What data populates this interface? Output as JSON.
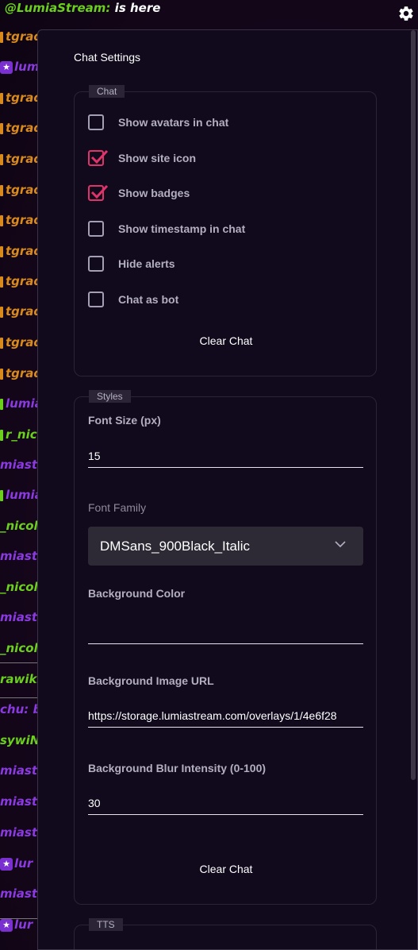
{
  "chat_feed": {
    "top_name": "@LumiaStream:",
    "top_msg": "is here",
    "lines": [
      {
        "text": "tgrad",
        "color": "orange",
        "mark": "dot-orange"
      },
      {
        "text": "lum",
        "color": "purple",
        "mark": "star"
      },
      {
        "text": "tgrad",
        "color": "orange",
        "mark": "dot-orange"
      },
      {
        "text": "tgrad",
        "color": "orange",
        "mark": "dot-orange"
      },
      {
        "text": "tgrad",
        "color": "orange",
        "mark": "dot-orange"
      },
      {
        "text": "tgrad",
        "color": "orange",
        "mark": "dot-orange"
      },
      {
        "text": "tgrad",
        "color": "orange",
        "mark": "dot-orange"
      },
      {
        "text": "tgrad",
        "color": "orange",
        "mark": "dot-orange"
      },
      {
        "text": "tgrad",
        "color": "orange",
        "mark": "dot-orange"
      },
      {
        "text": "tgrad",
        "color": "orange",
        "mark": "dot-orange"
      },
      {
        "text": "tgrad",
        "color": "orange",
        "mark": "dot-orange"
      },
      {
        "text": "tgrad",
        "color": "orange",
        "mark": "dot-orange"
      },
      {
        "text": "lumia",
        "color": "purple",
        "mark": "dot-green"
      },
      {
        "text": "r_nic",
        "color": "green",
        "mark": "dot-green"
      },
      {
        "text": "miast",
        "color": "purple",
        "mark": ""
      },
      {
        "text": "lumia",
        "color": "purple",
        "mark": "dot-green"
      },
      {
        "text": "_nicol",
        "color": "green",
        "mark": ""
      },
      {
        "text": "miast",
        "color": "purple",
        "mark": ""
      },
      {
        "text": "_nicol",
        "color": "green",
        "mark": ""
      },
      {
        "text": "miast",
        "color": "purple",
        "mark": ""
      },
      {
        "text": "_nicol",
        "color": "green",
        "mark": ""
      },
      {
        "text": "rawiks",
        "color": "green",
        "mark": ""
      },
      {
        "text": "chu: b",
        "color": "purple",
        "mark": ""
      },
      {
        "text": "sywiN",
        "color": "green",
        "mark": ""
      },
      {
        "text": "miast",
        "color": "purple",
        "mark": ""
      },
      {
        "text": "miast",
        "color": "purple",
        "mark": ""
      },
      {
        "text": "miast",
        "color": "purple",
        "mark": ""
      },
      {
        "text": "lur",
        "color": "purple",
        "mark": "star"
      },
      {
        "text": "miast",
        "color": "purple",
        "mark": ""
      },
      {
        "text": "lur",
        "color": "purple",
        "mark": "star"
      }
    ]
  },
  "panel": {
    "title": "Chat Settings",
    "chat_group": {
      "label": "Chat",
      "options": [
        {
          "label": "Show avatars in chat",
          "checked": false
        },
        {
          "label": "Show site icon",
          "checked": true
        },
        {
          "label": "Show badges",
          "checked": true
        },
        {
          "label": "Show timestamp in chat",
          "checked": false
        },
        {
          "label": "Hide alerts",
          "checked": false
        },
        {
          "label": "Chat as bot",
          "checked": false
        }
      ],
      "clear_label": "Clear Chat"
    },
    "styles_group": {
      "label": "Styles",
      "font_size_label": "Font Size (px)",
      "font_size_value": "15",
      "font_family_label": "Font Family",
      "font_family_value": "DMSans_900Black_Italic",
      "bg_color_label": "Background Color",
      "bg_color_value": "",
      "bg_image_label": "Background Image URL",
      "bg_image_value": "https://storage.lumiastream.com/overlays/1/4e6f28",
      "blur_label": "Background Blur Intensity (0-100)",
      "blur_value": "30",
      "clear_label": "Clear Chat"
    },
    "tts_group": {
      "label": "TTS"
    }
  },
  "colors": {
    "accent": "#e0336a",
    "panel_bg": "#110a1c",
    "orange": "#d98a1c",
    "purple": "#8a3ae0",
    "green": "#6ad01c"
  }
}
